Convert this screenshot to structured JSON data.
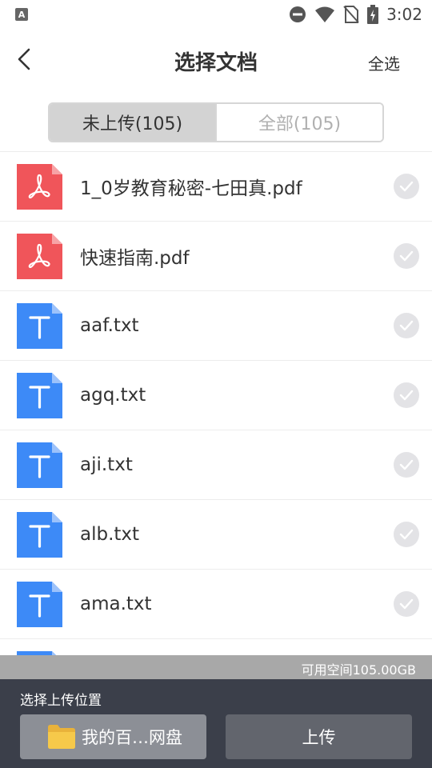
{
  "status_bar": {
    "time": "3:02",
    "icons": [
      "a-app-icon",
      "dnd-icon",
      "wifi-icon",
      "no-sim-icon",
      "battery-charging-icon"
    ]
  },
  "header": {
    "title": "选择文档",
    "select_all_label": "全选"
  },
  "tabs": [
    {
      "label": "未上传(105)",
      "active": true
    },
    {
      "label": "全部(105)",
      "active": false
    }
  ],
  "files": [
    {
      "name": "1_0岁教育秘密-七田真.pdf",
      "type": "pdf"
    },
    {
      "name": "快速指南.pdf",
      "type": "pdf"
    },
    {
      "name": "aaf.txt",
      "type": "txt"
    },
    {
      "name": "agq.txt",
      "type": "txt"
    },
    {
      "name": "aji.txt",
      "type": "txt"
    },
    {
      "name": "alb.txt",
      "type": "txt"
    },
    {
      "name": "ama.txt",
      "type": "txt"
    },
    {
      "name": "",
      "type": "txt"
    }
  ],
  "storage": {
    "available_text": "可用空间105.00GB"
  },
  "bottom": {
    "location_label": "选择上传位置",
    "location_value": "我的百…网盘",
    "upload_label": "上传"
  },
  "colors": {
    "pdf": "#f0555a",
    "txt": "#3d8af7",
    "bottom_bg": "#3b3f4a"
  }
}
